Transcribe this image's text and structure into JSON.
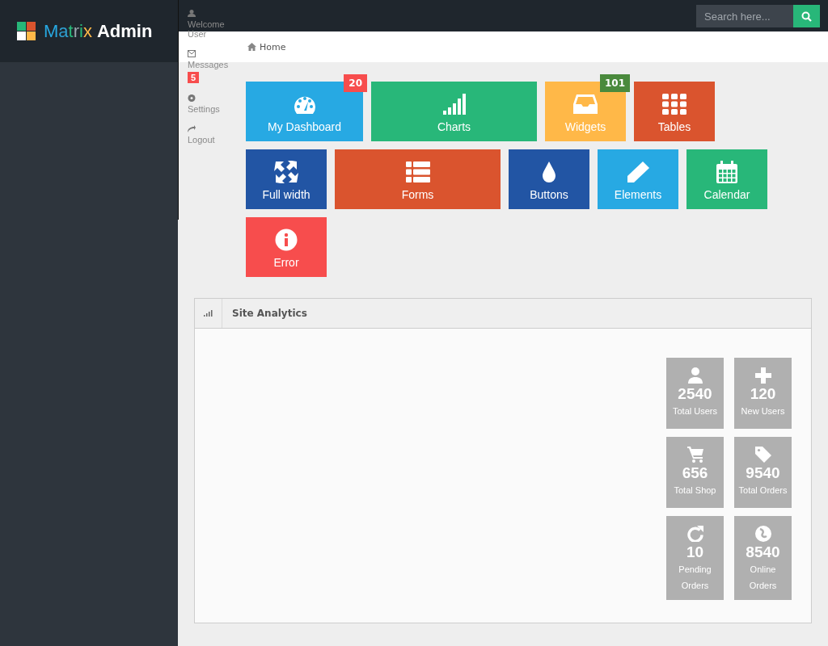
{
  "brand": {
    "name_light": "Matrix",
    "name_bold": "Admin"
  },
  "user_menu": [
    {
      "kind": "user",
      "label": "Welcome User"
    },
    {
      "kind": "messages",
      "label": "Messages",
      "badge": "5"
    },
    {
      "kind": "settings",
      "label": "Settings"
    },
    {
      "kind": "logout",
      "label": "Logout"
    }
  ],
  "search": {
    "placeholder": "Search here..."
  },
  "breadcrumb": {
    "label": "Home"
  },
  "tiles": [
    [
      {
        "label": "My Dashboard",
        "color": "#27a9e3",
        "badge": {
          "text": "20",
          "color": "#f74d4d"
        }
      },
      {
        "label": "Charts",
        "color": "#28b779"
      },
      {
        "label": "Widgets",
        "color": "#ffb848",
        "badge": {
          "text": "101",
          "color": "#4a8a3d"
        }
      },
      {
        "label": "Tables",
        "color": "#da542e"
      }
    ],
    [
      {
        "label": "Full width",
        "color": "#2255a4"
      },
      {
        "label": "Forms",
        "color": "#da542e"
      },
      {
        "label": "Buttons",
        "color": "#2255a4"
      },
      {
        "label": "Elements",
        "color": "#27a9e3"
      },
      {
        "label": "Calendar",
        "color": "#28b779"
      }
    ],
    [
      {
        "label": "Error",
        "color": "#f74d4d"
      }
    ]
  ],
  "analytics": {
    "title": "Site Analytics",
    "stats": [
      {
        "value": "2540",
        "label": "Total Users"
      },
      {
        "value": "120",
        "label": "New Users"
      },
      {
        "value": "656",
        "label": "Total Shop"
      },
      {
        "value": "9540",
        "label": "Total Orders"
      },
      {
        "value": "10",
        "label": "Pending Orders"
      },
      {
        "value": "8540",
        "label": "Online Orders"
      }
    ]
  }
}
